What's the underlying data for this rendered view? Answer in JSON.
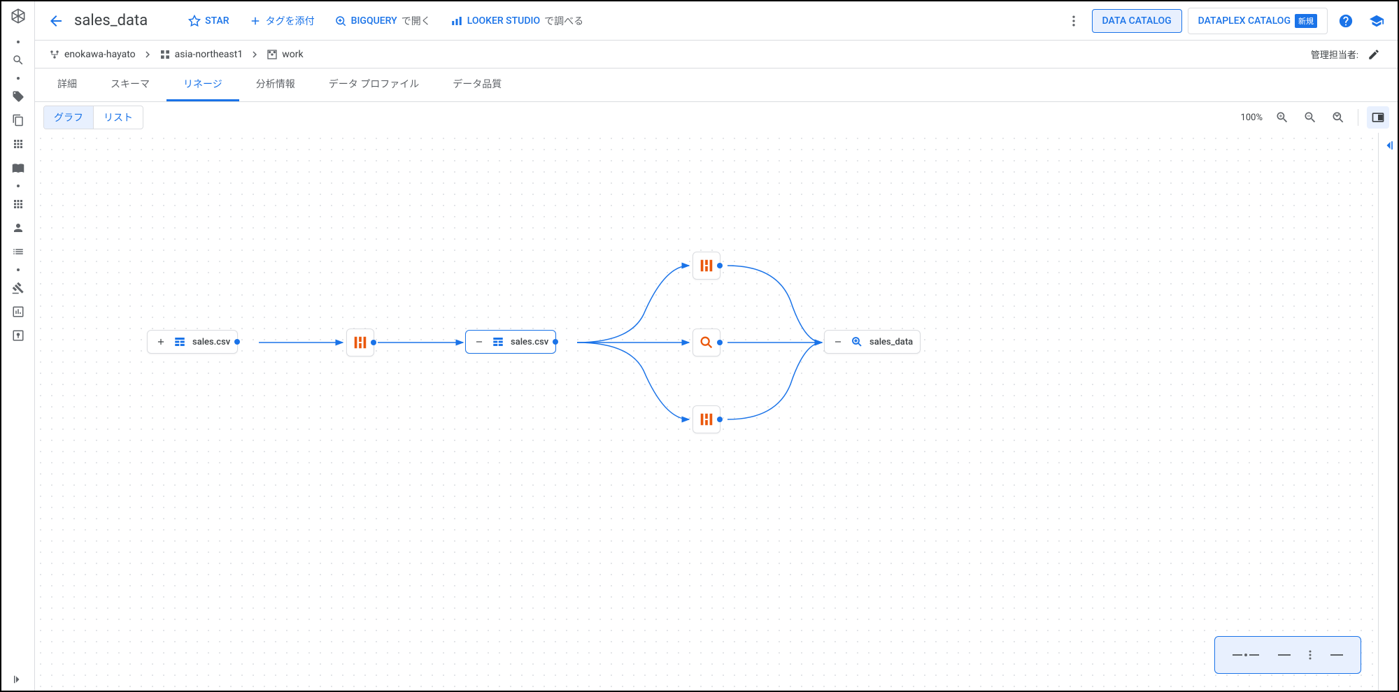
{
  "header": {
    "title": "sales_data",
    "actions": {
      "star": "STAR",
      "tag": "タグを添付",
      "bigquery_label": "BIGQUERY",
      "bigquery_suffix": "で開く",
      "looker_label": "LOOKER STUDIO",
      "looker_suffix": "で調べる"
    },
    "catalog_tabs": {
      "data_catalog": "DATA CATALOG",
      "dataplex_catalog": "DATAPLEX CATALOG",
      "new_badge": "新規"
    }
  },
  "breadcrumb": {
    "items": [
      {
        "label": "enokawa-hayato"
      },
      {
        "label": "asia-northeast1"
      },
      {
        "label": "work"
      }
    ],
    "admin_label": "管理担当者:"
  },
  "tabs": [
    {
      "label": "詳細",
      "active": false
    },
    {
      "label": "スキーマ",
      "active": false
    },
    {
      "label": "リネージ",
      "active": true
    },
    {
      "label": "分析情報",
      "active": false
    },
    {
      "label": "データ プロファイル",
      "active": false
    },
    {
      "label": "データ品質",
      "active": false
    }
  ],
  "lineage_toolbar": {
    "view_modes": {
      "graph": "グラフ",
      "list": "リスト"
    },
    "zoom": "100%"
  },
  "graph": {
    "nodes": {
      "n1": {
        "label": "sales.csv",
        "type": "table",
        "expand": "plus"
      },
      "n2": {
        "type": "transform"
      },
      "n3": {
        "label": "sales.csv",
        "type": "table",
        "expand": "minus",
        "selected": true
      },
      "n4": {
        "type": "transform"
      },
      "n5": {
        "type": "query"
      },
      "n6": {
        "type": "transform"
      },
      "n7": {
        "label": "sales_data",
        "type": "bigquery",
        "expand": "minus"
      }
    }
  }
}
